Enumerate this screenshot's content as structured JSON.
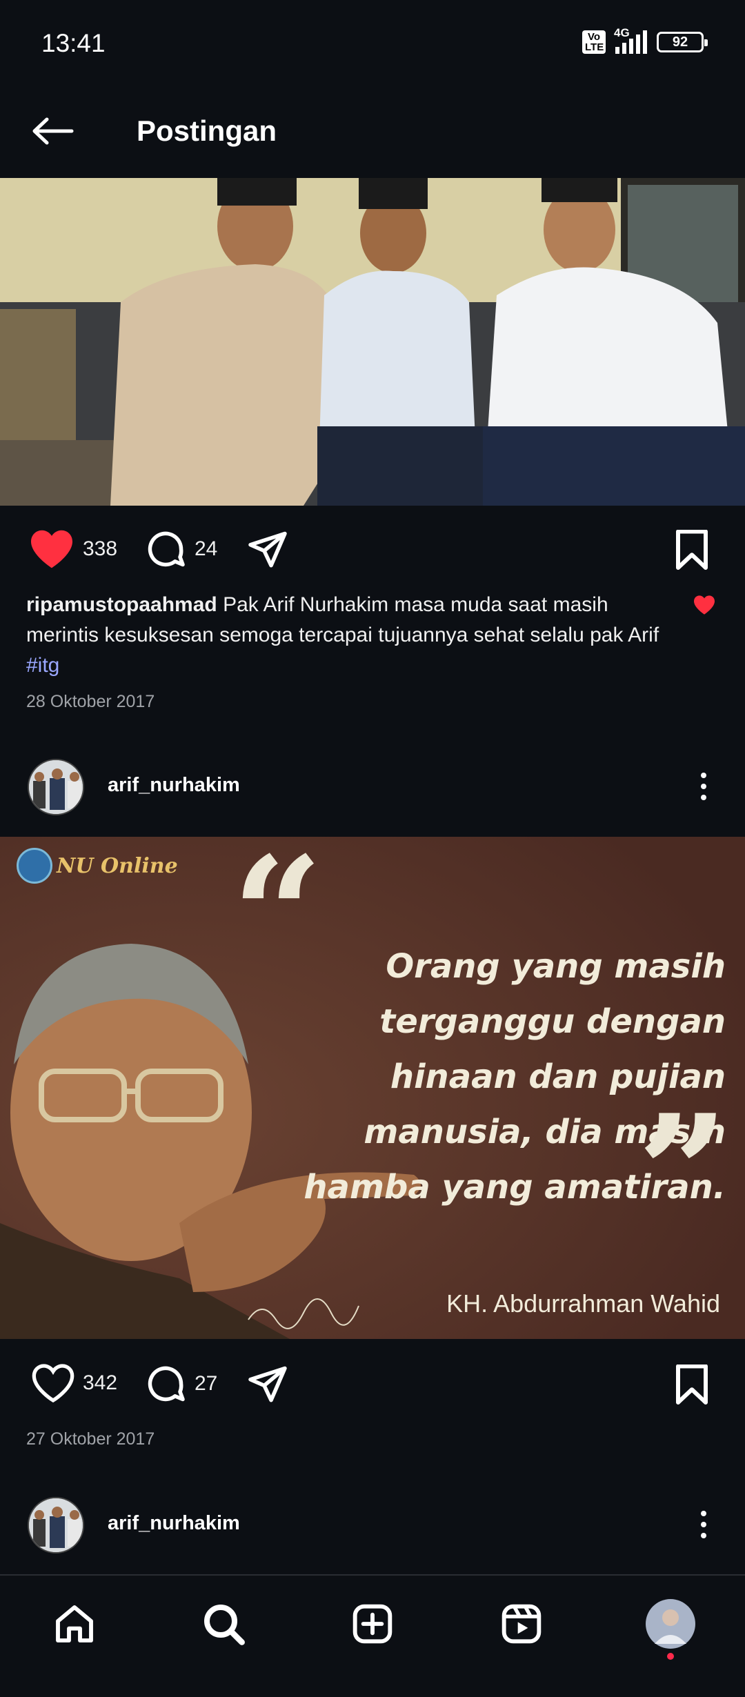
{
  "status_bar": {
    "time": "13:41",
    "volte": "Vo LTE",
    "network": "4G",
    "battery": "92"
  },
  "header": {
    "title": "Postingan"
  },
  "posts": [
    {
      "likes": "338",
      "comments": "24",
      "caption_user": "ripamustopaahmad",
      "caption_text": "Pak Arif Nurhakim masa muda saat masih merintis kesuksesan semoga tercapai tujuannya sehat selalu pak Arif ",
      "hashtag": "#itg",
      "date": "28 Oktober 2017",
      "liked": true
    },
    {
      "username": "arif_nurhakim",
      "image": {
        "logo_text": "NU Online",
        "open_quote": "“",
        "quote_text": "Orang yang masih terganggu dengan hinaan dan pujian manusia, dia masih hamba yang amatiran.",
        "close_quote": "”",
        "author": "KH. Abdurrahman Wahid"
      },
      "likes": "342",
      "comments": "27",
      "date": "27 Oktober 2017",
      "liked": false
    },
    {
      "username": "arif_nurhakim"
    }
  ],
  "bottom_nav": [
    "home-icon",
    "search-icon",
    "create-icon",
    "reels-icon",
    "profile-avatar"
  ],
  "colors": {
    "background": "#0c0f14",
    "like_red": "#ff3040",
    "hashtag": "#9aa7ff"
  }
}
